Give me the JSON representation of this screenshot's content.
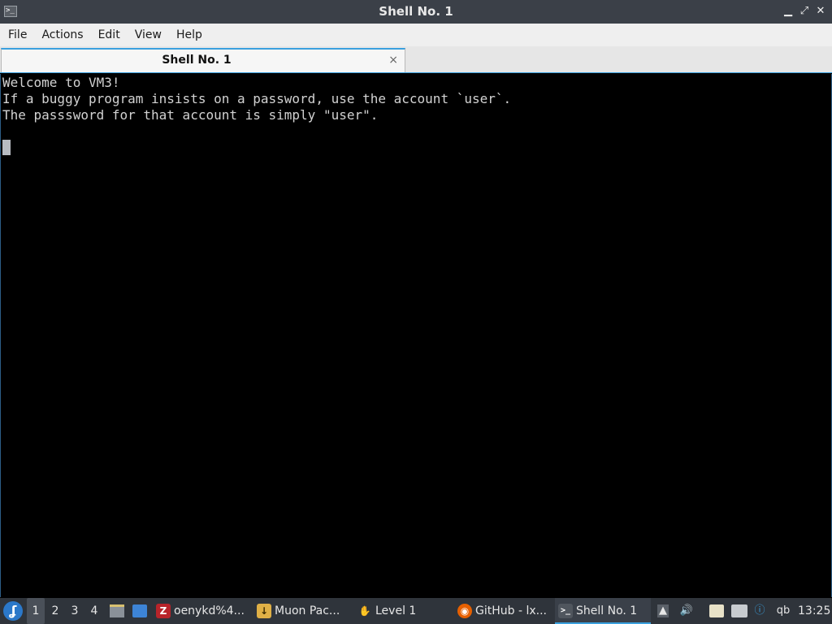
{
  "window": {
    "title": "Shell No. 1",
    "icon": "terminal-icon",
    "controls": {
      "minimize": "▁",
      "restore": "⤢",
      "close": "✕"
    }
  },
  "menubar": {
    "items": [
      {
        "label": "File"
      },
      {
        "label": "Actions"
      },
      {
        "label": "Edit"
      },
      {
        "label": "View"
      },
      {
        "label": "Help"
      }
    ]
  },
  "tabs": [
    {
      "label": "Shell No. 1",
      "close": "×",
      "active": true
    }
  ],
  "terminal": {
    "lines": [
      "Welcome to VM3!",
      "If a buggy program insists on a password, use the account `user`.",
      "The passsword for that account is simply \"user\"."
    ]
  },
  "taskbar": {
    "start_icon": "start-menu-icon",
    "workspaces": [
      "1",
      "2",
      "3",
      "4"
    ],
    "active_workspace": "1",
    "tasks": [
      {
        "label": "oenykd%4...",
        "icon": "filezilla-icon"
      },
      {
        "label": "Muon Pac...",
        "icon": "package-manager-icon"
      },
      {
        "label": "Level 1",
        "icon": "level-icon"
      },
      {
        "label": "GitHub - lx...",
        "icon": "firefox-icon"
      },
      {
        "label": "Shell No. 1",
        "icon": "terminal-icon",
        "active": true
      }
    ],
    "tray": {
      "qb": "qb"
    },
    "clock": "13:25"
  },
  "colors": {
    "accent": "#3aa0de",
    "titlebar": "#3b4048",
    "taskbar": "#2f343b",
    "terminal_bg": "#000000",
    "terminal_fg": "#d2d2d2"
  }
}
